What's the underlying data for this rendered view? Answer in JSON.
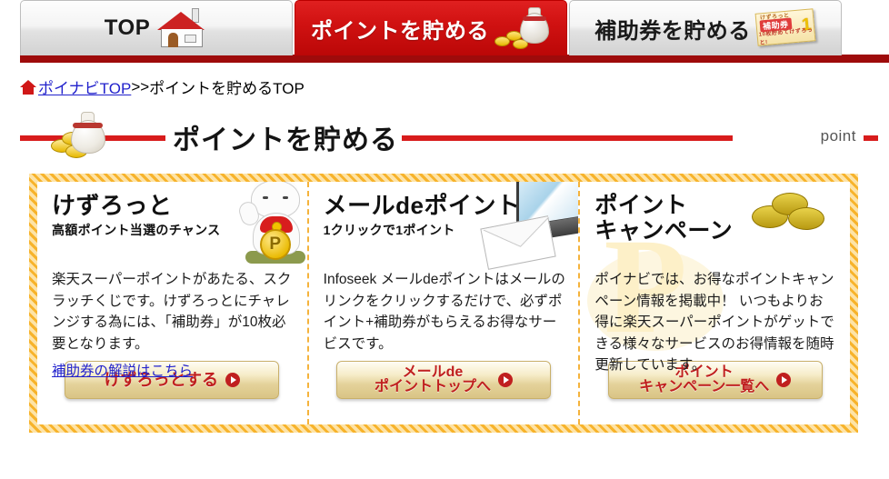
{
  "tabs": [
    {
      "label": "TOP",
      "icon": "house-icon",
      "active": false
    },
    {
      "label": "ポイントを貯める",
      "icon": "money-bag-icon",
      "active": true
    },
    {
      "label": "補助券を貯める",
      "icon": "coupon-ticket-icon",
      "active": false
    }
  ],
  "breadcrumb": {
    "home_icon": "home-icon",
    "link": "ポイナビTOP",
    "separator": ">>",
    "current": "ポイントを貯めるTOP"
  },
  "section": {
    "title": "ポイントを貯める",
    "side_label": "point",
    "icon": "money-bag-coins-icon"
  },
  "cards": [
    {
      "title": "けずろっと",
      "subtitle": "高額ポイント当選のチャンス",
      "body": "楽天スーパーポイントがあたる、スクラッチくじです。けずろっとにチャレンジする為には、「補助券」が10枚必要となります。",
      "link": "補助券の解説はこちら",
      "button": "けずろっとする",
      "art": "maneki-neko-icon"
    },
    {
      "title": "メールdeポイント",
      "subtitle": "1クリックで1ポイント",
      "body": "Infoseek メールdeポイントはメールのリンクをクリックするだけで、必ずポイント+補助券がもらえるお得なサービスです。",
      "link": "",
      "button": "メールde\nポイントトップへ",
      "art": "laptop-envelope-icon"
    },
    {
      "title": "ポイント\nキャンペーン",
      "subtitle": "",
      "body": "ポイナビでは、お得なポイントキャンペーン情報を掲載中！ いつもよりお得に楽天スーパーポイントがゲットできる様々なサービスのお得情報を随時更新しています。",
      "link": "",
      "button": "ポイント\nキャンペーン一覧へ",
      "art": "gold-coins-icon"
    }
  ],
  "colors": {
    "active_tab_red": "#d11212",
    "rule_red": "#d81c1c",
    "border_orange": "#f7b32b",
    "link_blue": "#2222cc",
    "button_text_red": "#c01f1f"
  }
}
